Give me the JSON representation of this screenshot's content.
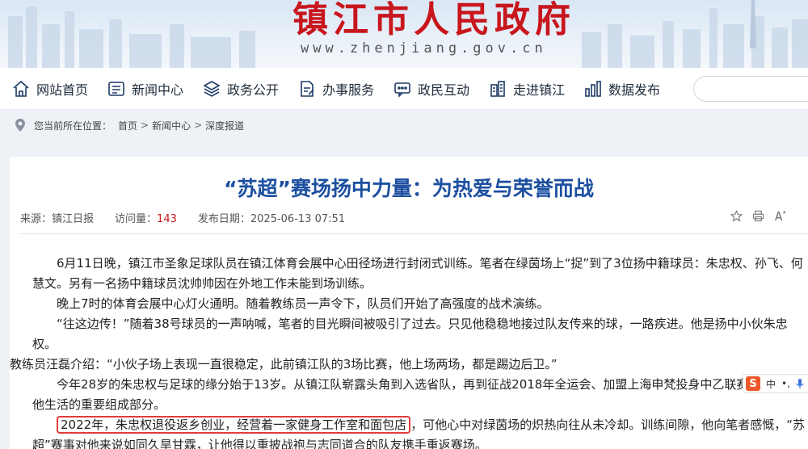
{
  "site": {
    "title": "镇江市人民政府",
    "url": "www.zhenjiang.gov.cn"
  },
  "nav": [
    {
      "label": "网站首页",
      "icon": "home-icon"
    },
    {
      "label": "新闻中心",
      "icon": "newspaper-icon"
    },
    {
      "label": "政务公开",
      "icon": "layers-icon"
    },
    {
      "label": "办事服务",
      "icon": "document-edit-icon"
    },
    {
      "label": "政民互动",
      "icon": "chat-icon"
    },
    {
      "label": "走进镇江",
      "icon": "building-icon"
    },
    {
      "label": "数据发布",
      "icon": "bar-chart-icon"
    }
  ],
  "breadcrumb": {
    "prefix": "您当前所在位置：",
    "items": [
      "首页",
      "新闻中心",
      "深度报道"
    ],
    "separator": ">"
  },
  "article": {
    "title": "“苏超”赛场扬中力量：为热爱与荣誉而战",
    "source_label": "来源：",
    "source": "镇江日报",
    "views_label": "访问量：",
    "views": "143",
    "date_label": "发布日期：",
    "date": "2025-06-13 07:51",
    "paragraphs": [
      "6月11日晚，镇江市圣象足球队员在镇江体育会展中心田径场进行封闭式训练。笔者在绿茵场上“捉”到了3位扬中籍球员：朱忠权、孙飞、何慧文。另有一名扬中籍球员沈帅帅因在外地工作未能到场训练。",
      "晚上7时的体育会展中心灯火通明。随着教练员一声令下，队员们开始了高强度的战术演练。",
      "“往这边传！”随着38号球员的一声呐喊，笔者的目光瞬间被吸引了过去。只见他稳稳地接过队友传来的球，一路疾进。他是扬中小伙朱忠权。",
      "教练员汪磊介绍：“小伙子场上表现一直很稳定，此前镇江队的3场比赛，他上场两场，都是踢边后卫。”",
      "今年28岁的朱忠权与足球的缘分始于13岁。从镇江队崭露头角到入选省队，再到征战2018年全运会、加盟上海申梵投身中乙联赛，足球是他生活的重要组成部分。"
    ],
    "highlight": "2022年，朱忠权退役返乡创业，经营着一家健身工作室和面包店",
    "last_paragraph_rest": "，可他心中对绿茵场的炽热向往从未冷却。训练间隙，他向笔者感慨，“苏超”赛事对他来说如同久旱甘霖，让他得以重披战袍与志同道合的队友携手重返赛场。"
  },
  "ime": {
    "label": "中",
    "extra": "•,"
  }
}
